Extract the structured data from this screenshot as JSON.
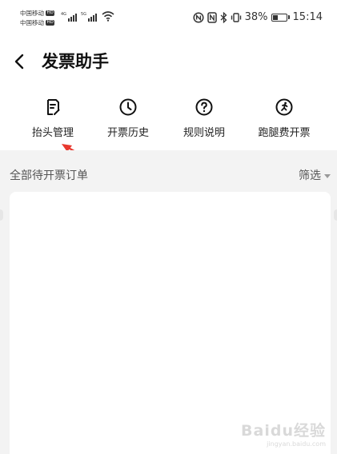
{
  "status_bar": {
    "carrier_1": "中国移动",
    "carrier_2": "中国移动",
    "hd_badge": "HD",
    "net_tag_1": "4G",
    "net_tag_2": "5G",
    "battery_percent": "38%",
    "time": "15:14",
    "battery_level": 0.38,
    "icons": [
      "wifi-icon",
      "nfc-icon",
      "bluetooth-icon",
      "vibrate-icon"
    ]
  },
  "header": {
    "title": "发票助手",
    "back_icon": "chevron-left-icon"
  },
  "quick_actions": [
    {
      "label": "抬头管理",
      "icon": "document-edit-icon"
    },
    {
      "label": "开票历史",
      "icon": "clock-icon"
    },
    {
      "label": "规则说明",
      "icon": "question-circle-icon"
    },
    {
      "label": "跑腿费开票",
      "icon": "runner-circle-icon"
    }
  ],
  "orders": {
    "section_title": "全部待开票订单",
    "filter_label": "筛选"
  },
  "watermark": {
    "main": "Baidu经验",
    "sub": "jingyan.baidu.com"
  },
  "colors": {
    "annotation_arrow": "#e8392f",
    "section_bg": "#f3f3f3",
    "text_primary": "#111111"
  }
}
